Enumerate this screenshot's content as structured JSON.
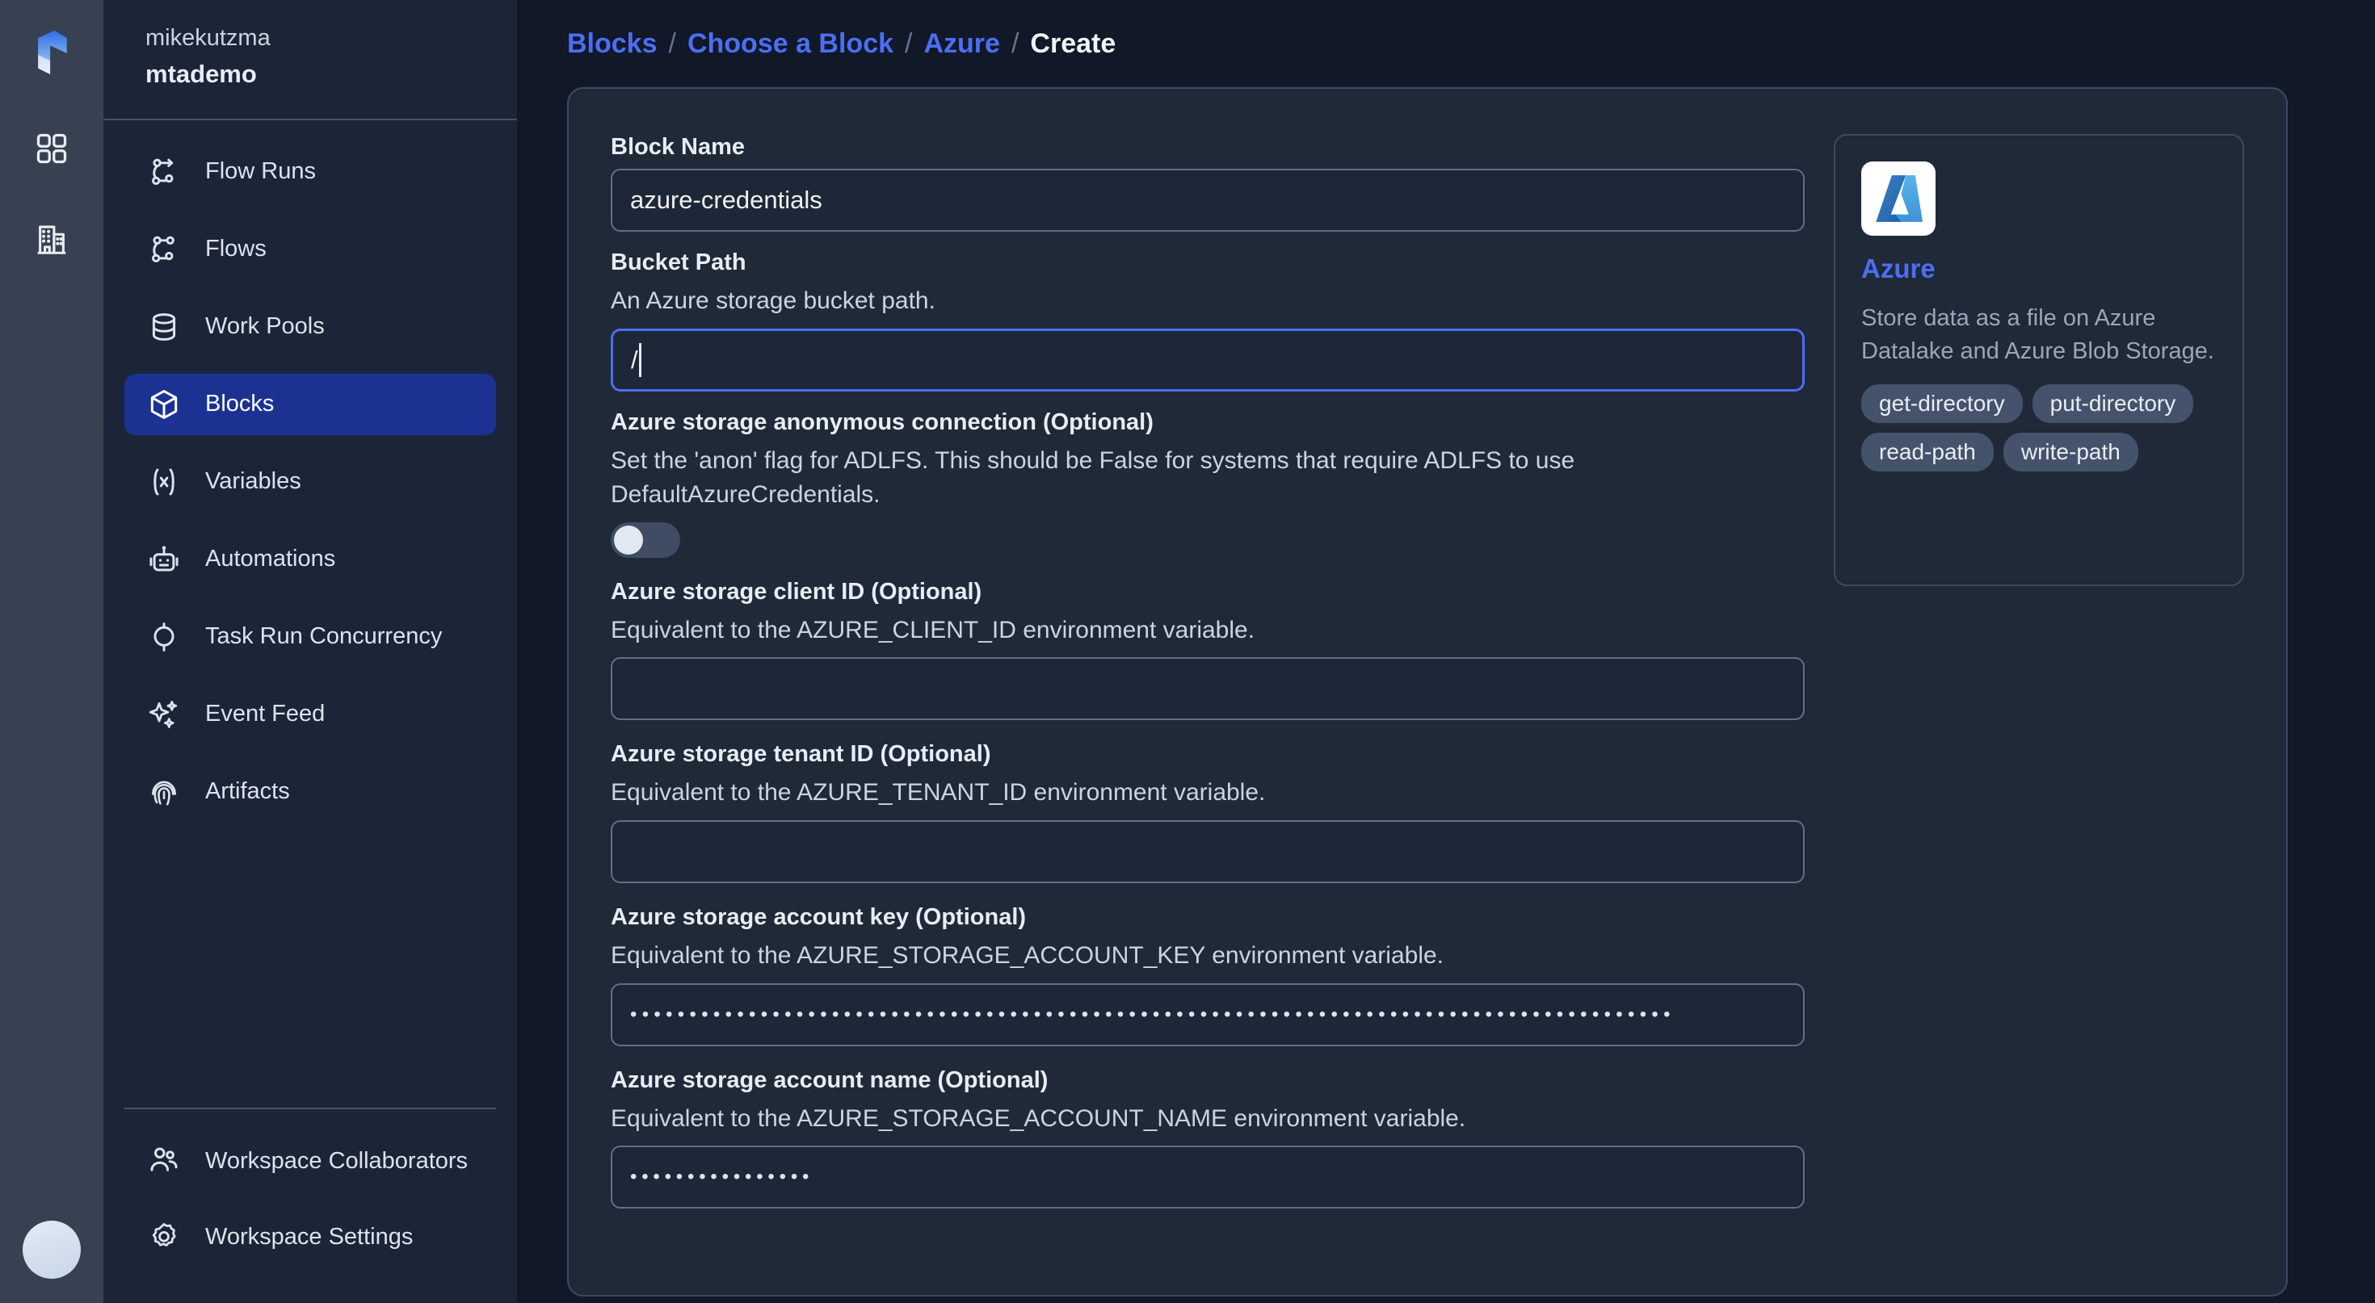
{
  "rail": {
    "logo_icon": "prefect-logo-icon",
    "icons": [
      {
        "name": "dashboard-grid-icon"
      },
      {
        "name": "organization-building-icon"
      }
    ],
    "avatar_name": "user-avatar"
  },
  "sidebar": {
    "user": "mikekutzma",
    "workspace": "mtademo",
    "items": [
      {
        "label": "Flow Runs",
        "icon": "flow-runs-icon",
        "active": false
      },
      {
        "label": "Flows",
        "icon": "flows-icon",
        "active": false
      },
      {
        "label": "Work Pools",
        "icon": "work-pools-database-icon",
        "active": false
      },
      {
        "label": "Blocks",
        "icon": "blocks-cube-icon",
        "active": true
      },
      {
        "label": "Variables",
        "icon": "variables-x-icon",
        "active": false
      },
      {
        "label": "Automations",
        "icon": "automations-robot-icon",
        "active": false
      },
      {
        "label": "Task Run Concurrency",
        "icon": "task-run-concurrency-icon",
        "active": false
      },
      {
        "label": "Event Feed",
        "icon": "event-feed-sparkle-icon",
        "active": false
      },
      {
        "label": "Artifacts",
        "icon": "artifacts-fingerprint-icon",
        "active": false
      }
    ],
    "bottom_items": [
      {
        "label": "Workspace Collaborators",
        "icon": "collaborators-people-icon"
      },
      {
        "label": "Workspace Settings",
        "icon": "gear-icon"
      }
    ]
  },
  "breadcrumb": {
    "items": [
      {
        "label": "Blocks",
        "link": true
      },
      {
        "label": "Choose a Block",
        "link": true
      },
      {
        "label": "Azure",
        "link": true
      },
      {
        "label": "Create",
        "link": false
      }
    ],
    "separator": "/"
  },
  "form": {
    "block_name": {
      "label": "Block Name",
      "value": "azure-credentials",
      "placeholder": ""
    },
    "bucket_path": {
      "label": "Bucket Path",
      "description": "An Azure storage bucket path.",
      "value": "/",
      "focused": true
    },
    "anon_connection": {
      "label": "Azure storage anonymous connection (Optional)",
      "description": "Set the 'anon' flag for ADLFS. This should be False for systems that require ADLFS to use DefaultAzureCredentials.",
      "toggle_on": false
    },
    "client_id": {
      "label": "Azure storage client ID (Optional)",
      "description": "Equivalent to the AZURE_CLIENT_ID environment variable.",
      "value": ""
    },
    "tenant_id": {
      "label": "Azure storage tenant ID (Optional)",
      "description": "Equivalent to the AZURE_TENANT_ID environment variable.",
      "value": ""
    },
    "account_key": {
      "label": "Azure storage account key (Optional)",
      "description": "Equivalent to the AZURE_STORAGE_ACCOUNT_KEY environment variable.",
      "masked_value": "••••••••••••••••••••••••••••••••••••••••••••••••••••••••••••••••••••••••••••••••••••••••"
    },
    "account_name": {
      "label": "Azure storage account name (Optional)",
      "description": "Equivalent to the AZURE_STORAGE_ACCOUNT_NAME environment variable.",
      "masked_value": "••••••••••••••••"
    }
  },
  "info_card": {
    "logo_icon": "azure-logo-icon",
    "title": "Azure",
    "description": "Store data as a file on Azure Datalake and Azure Blob Storage.",
    "capabilities": [
      "get-directory",
      "put-directory",
      "read-path",
      "write-path"
    ]
  },
  "colors": {
    "accent": "#4c6ef5",
    "active_nav": "#1b3293",
    "page_bg": "#111827",
    "sidebar_bg": "#1c2537",
    "rail_bg": "#374151",
    "panel_bg": "#1f2937"
  }
}
